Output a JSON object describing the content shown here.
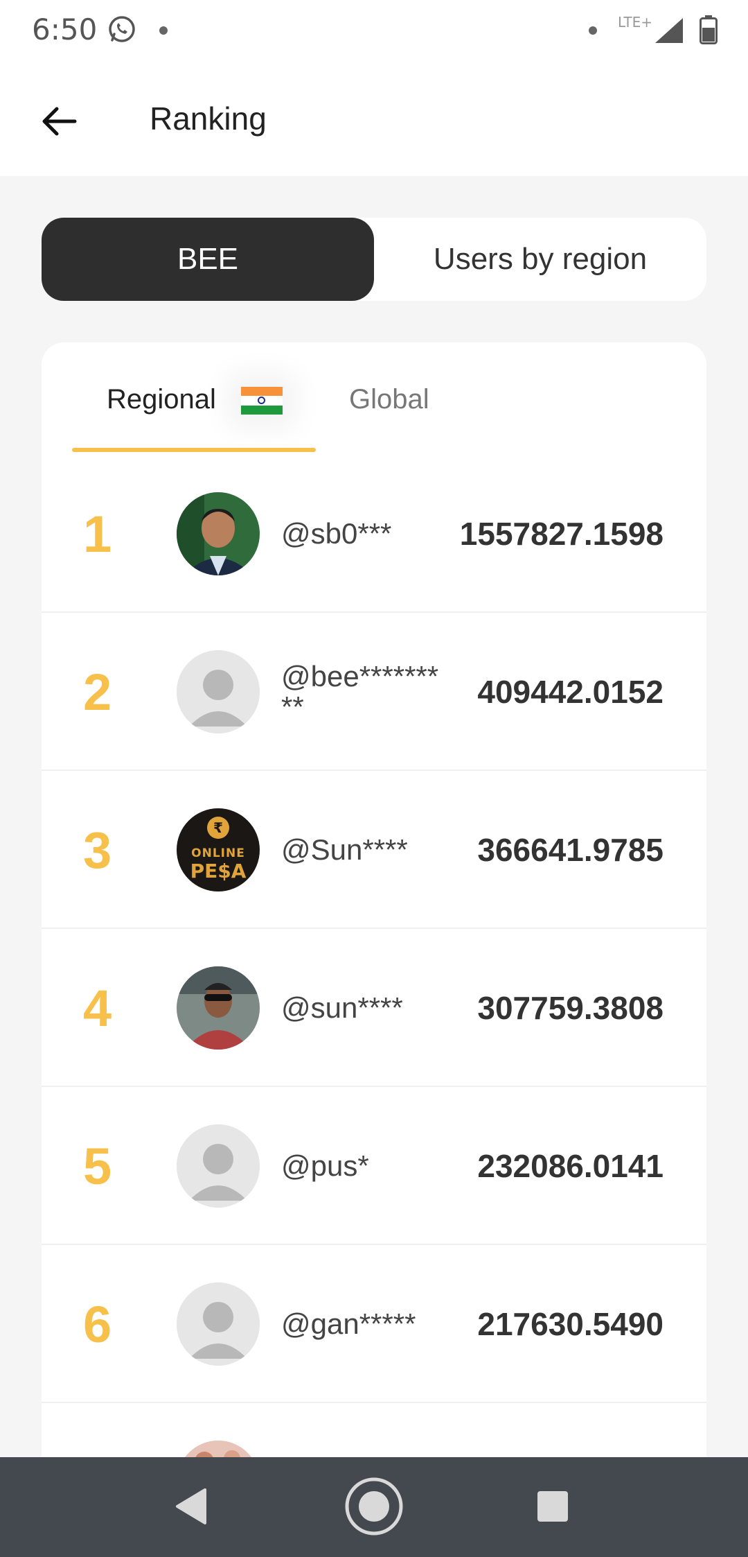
{
  "status_bar": {
    "time": "6:50",
    "network": "LTE+"
  },
  "header": {
    "title": "Ranking"
  },
  "segment": {
    "bee_label": "BEE",
    "region_label": "Users by region"
  },
  "tabs": {
    "regional_label": "Regional",
    "global_label": "Global"
  },
  "ranking": [
    {
      "rank": "1",
      "user": "@sb0***",
      "score": "1557827.1598",
      "avatar": "photo"
    },
    {
      "rank": "2",
      "user": "@bee*********",
      "score": "409442.0152",
      "avatar": "placeholder"
    },
    {
      "rank": "3",
      "user": "@Sun****",
      "score": "366641.9785",
      "avatar": "online-pesa-logo"
    },
    {
      "rank": "4",
      "user": "@sun****",
      "score": "307759.3808",
      "avatar": "photo"
    },
    {
      "rank": "5",
      "user": "@pus*",
      "score": "232086.0141",
      "avatar": "placeholder"
    },
    {
      "rank": "6",
      "user": "@gan*****",
      "score": "217630.5490",
      "avatar": "placeholder"
    },
    {
      "rank": "7",
      "user": "",
      "score": "",
      "avatar": "photo"
    }
  ],
  "logo_text": {
    "line1": "ONLINE",
    "line2": "PE$A"
  },
  "colors": {
    "accent": "#f7c04a",
    "dark": "#2e2e2e",
    "nav_bar": "#444950"
  }
}
